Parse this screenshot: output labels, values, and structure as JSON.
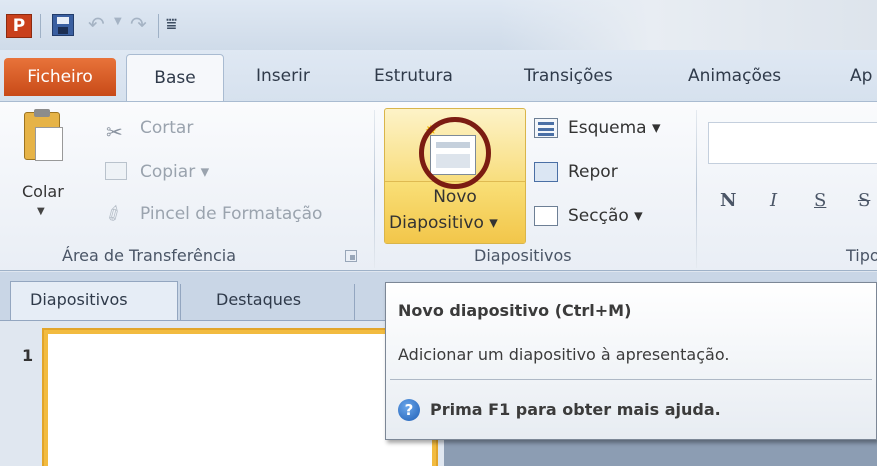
{
  "quick_access": {
    "app_icon": "P",
    "icons": [
      "save-icon",
      "undo-icon",
      "redo-icon",
      "customize-icon"
    ]
  },
  "tabs": {
    "file": "Ficheiro",
    "items": [
      "Base",
      "Inserir",
      "Estrutura",
      "Transições",
      "Animações",
      "Ap"
    ]
  },
  "clipboard": {
    "paste": "Colar",
    "cut": "Cortar",
    "copy": "Copiar",
    "format_painter": "Pincel de Formatação",
    "group_label": "Área de Transferência"
  },
  "slides": {
    "new_slide_line1": "Novo",
    "new_slide_line2": "Diapositivo",
    "layout": "Esquema",
    "reset": "Repor",
    "section": "Secção",
    "group_label": "Diapositivos"
  },
  "font": {
    "bold": "N",
    "italic": "I",
    "underline": "S",
    "strike": "S",
    "group_label": "Tipo"
  },
  "pane_tabs": {
    "slides": "Diapositivos",
    "outline": "Destaques"
  },
  "slide_list": {
    "number": "1"
  },
  "tooltip": {
    "title": "Novo diapositivo (Ctrl+M)",
    "description": "Adicionar um diapositivo à apresentação.",
    "help": "Prima F1 para obter mais ajuda."
  }
}
